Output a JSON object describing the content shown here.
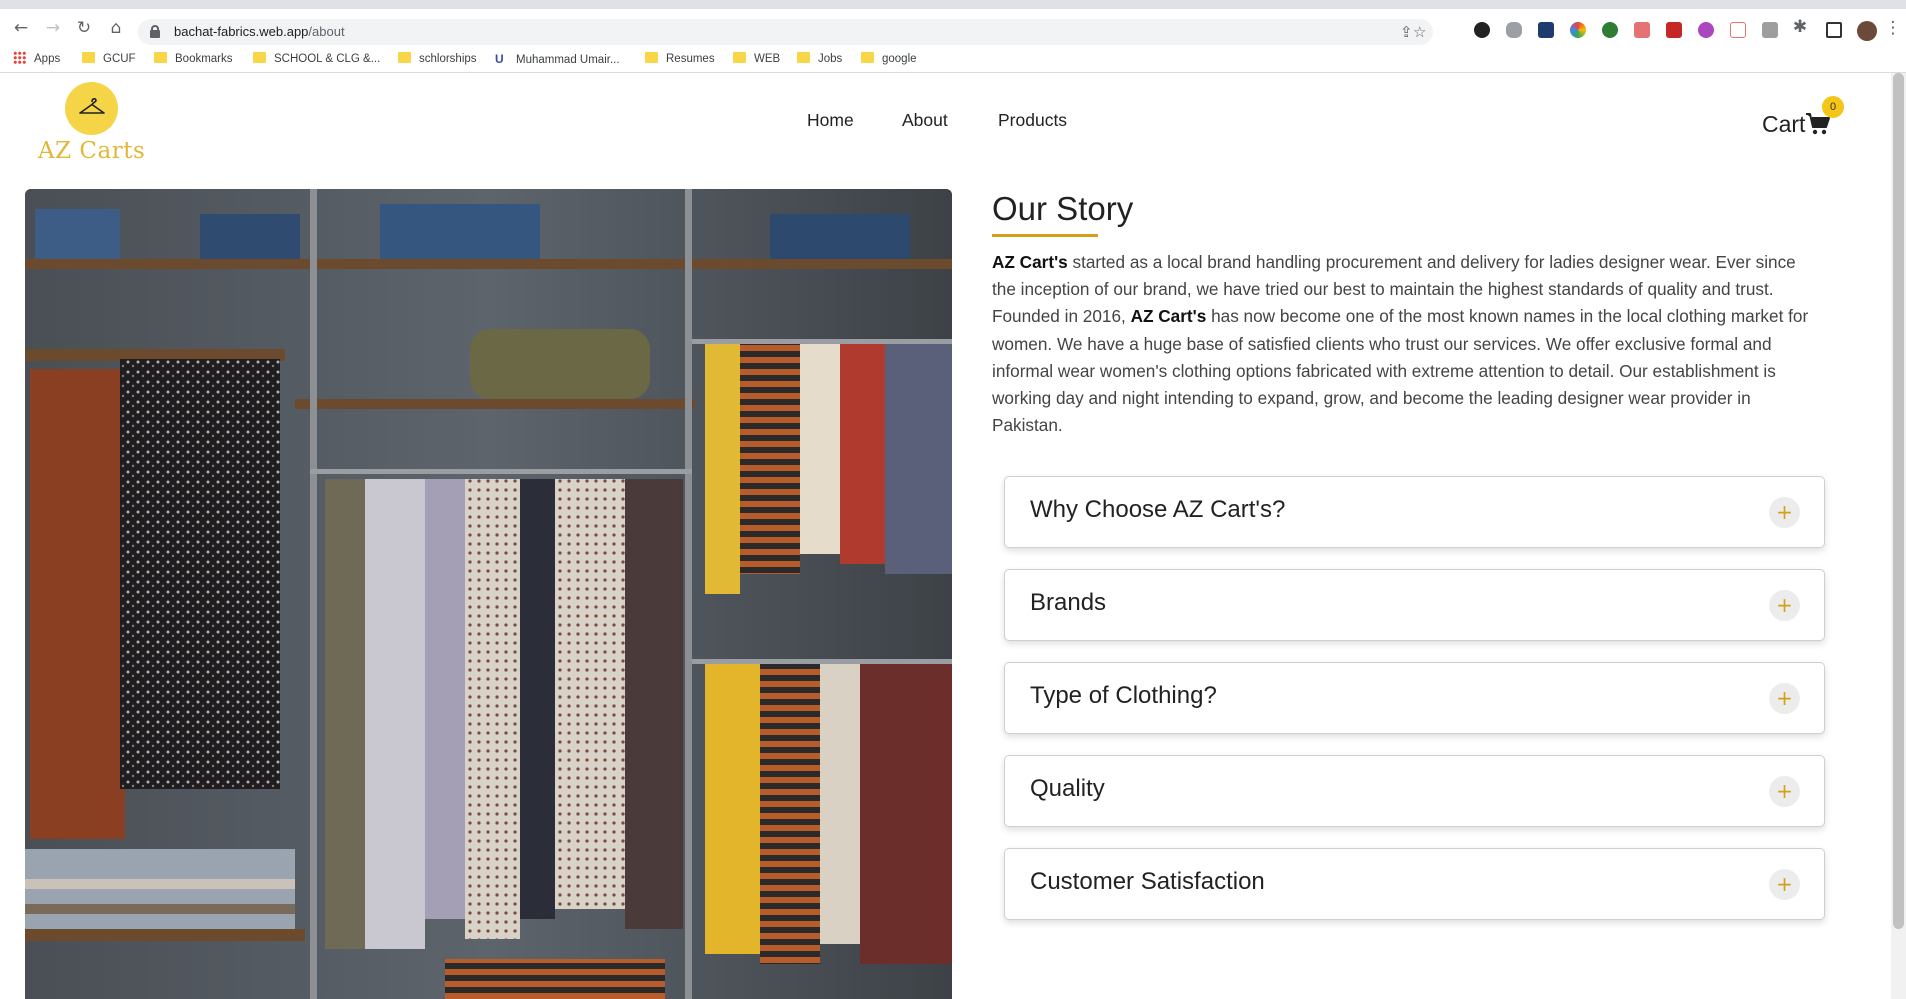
{
  "browser": {
    "url_host": "bachat-fabrics.web.app",
    "url_path": "/about",
    "bookmarks": [
      {
        "label": "Apps",
        "type": "apps"
      },
      {
        "label": "GCUF",
        "type": "folder"
      },
      {
        "label": "Bookmarks",
        "type": "folder"
      },
      {
        "label": "SCHOOL & CLG &...",
        "type": "folder"
      },
      {
        "label": "schlorships",
        "type": "folder"
      },
      {
        "label": "Muhammad Umair...",
        "type": "site"
      },
      {
        "label": "Resumes",
        "type": "folder"
      },
      {
        "label": "WEB",
        "type": "folder"
      },
      {
        "label": "Jobs",
        "type": "folder"
      },
      {
        "label": "google",
        "type": "folder"
      }
    ]
  },
  "site": {
    "brand": "AZ Carts",
    "nav": [
      "Home",
      "About",
      "Products"
    ],
    "cart_label": "Cart",
    "cart_count": "0"
  },
  "story": {
    "title": "Our Story",
    "brand_bold": "AZ Cart's",
    "p1": " started as a local brand handling procurement and delivery for ladies designer wear. Ever since the inception of our brand, we have tried our best to maintain the highest standards of quality and trust. Founded in 2016, ",
    "p2": " has now become one of the most known names in the local clothing market for women. We have a huge base of satisfied clients who trust our services. We offer exclusive formal and informal wear women's clothing options fabricated with extreme attention to detail. Our establishment is working day and night intending to expand, grow, and become the leading designer wear provider in Pakistan."
  },
  "accordion": [
    {
      "label": "Why Choose AZ Cart's?"
    },
    {
      "label": "Brands"
    },
    {
      "label": "Type of Clothing?"
    },
    {
      "label": "Quality"
    },
    {
      "label": "Customer Satisfaction"
    }
  ],
  "colors": {
    "accent": "#d4a017",
    "logo_bg": "#f5d547",
    "badge": "#f5c518"
  }
}
